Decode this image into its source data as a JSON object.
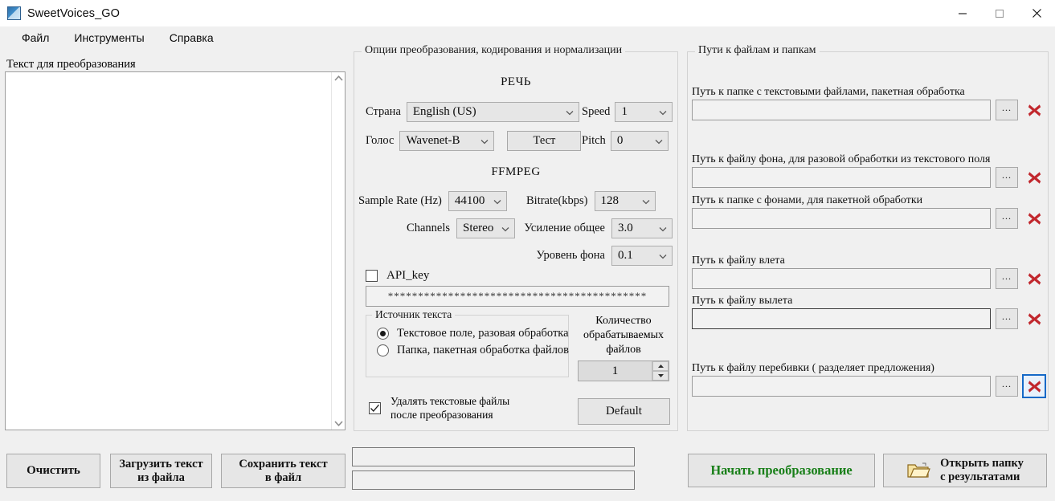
{
  "window": {
    "title": "SweetVoices_GO",
    "icon": "app-icon",
    "controls": {
      "minimize": "—",
      "maximize": "□",
      "close": "✕"
    }
  },
  "menubar": {
    "items": [
      "Файл",
      "Инструменты",
      "Справка"
    ]
  },
  "left_panel": {
    "textarea_label": "Текст для преобразования",
    "textarea_value": "",
    "scroll_up_icon": "chevron-up-icon",
    "scroll_down_icon": "chevron-down-icon"
  },
  "options": {
    "group_title": "Опции преобразования, кодирования и нормализации",
    "speech_title": "РЕЧЬ",
    "ffmpeg_title": "FFMPEG",
    "country_label": "Страна",
    "country_value": "English (US)",
    "speed_label": "Speed",
    "speed_value": "1",
    "voice_label": "Голос",
    "voice_value": "Wavenet-B",
    "test_button": "Тест",
    "pitch_label": "Pitch",
    "pitch_value": "0",
    "sample_rate_label": "Sample Rate (Hz)",
    "sample_rate_value": "44100",
    "bitrate_label": "Bitrate(kbps)",
    "bitrate_value": "128",
    "channels_label": "Channels",
    "channels_value": "Stereo",
    "gain_label": "Усиление общее",
    "gain_value": "3.0",
    "bg_level_label": "Уровень фона",
    "bg_level_value": "0.1",
    "api_key_label": "API_key",
    "api_key_checked": false,
    "api_key_value": "*******************************************",
    "source_group": "Источник текста",
    "source_option_1": "Текстовое поле, разовая обработка",
    "source_option_2": "Папка, пакетная обработка файлов",
    "source_selected": 1,
    "count_label_line1": "Количество",
    "count_label_line2": "обрабатываемых",
    "count_label_line3": "файлов",
    "count_value": "1",
    "delete_label_line1": "Удалять текстовые файлы",
    "delete_label_line2": "после преобразования",
    "delete_checked": true,
    "default_button": "Default"
  },
  "paths": {
    "group_title": "Пути к файлам и папкам",
    "browse_button": "...",
    "clear_icon": "red-x-icon",
    "fields": [
      {
        "label": "Путь к папке с текстовыми файлами, пакетная обработка",
        "value": "",
        "focused": false,
        "clear_focused": false
      },
      {
        "label": "Путь к файлу фона, для разовой обработки из текстового поля",
        "value": "",
        "focused": false,
        "clear_focused": false
      },
      {
        "label": "Путь к папке с фонами, для пакетной обработки",
        "value": "",
        "focused": false,
        "clear_focused": false
      },
      {
        "label": "Путь к файлу влета",
        "value": "",
        "focused": false,
        "clear_focused": false
      },
      {
        "label": "Путь к файлу вылета",
        "value": "",
        "focused": true,
        "clear_focused": false
      },
      {
        "label": "Путь к файлу перебивки ( разделяет предложения)",
        "value": "",
        "focused": false,
        "clear_focused": true
      }
    ]
  },
  "bottom": {
    "clear_button": "Очистить",
    "load_button_line1": "Загрузить текст",
    "load_button_line2": "из файла",
    "save_button_line1": "Сохранить текст",
    "save_button_line2": "в файл",
    "progress1_value": "",
    "progress2_value": "",
    "start_button": "Начать преобразование",
    "open_folder_line1": "Открыть папку",
    "open_folder_line2": "с результатами",
    "folder_icon": "folder-icon"
  },
  "colors": {
    "start_button_text": "#187f18",
    "clear_x": "#c1272d",
    "focus_ring": "#1569c7",
    "window_bg": "#f0f0f0"
  }
}
